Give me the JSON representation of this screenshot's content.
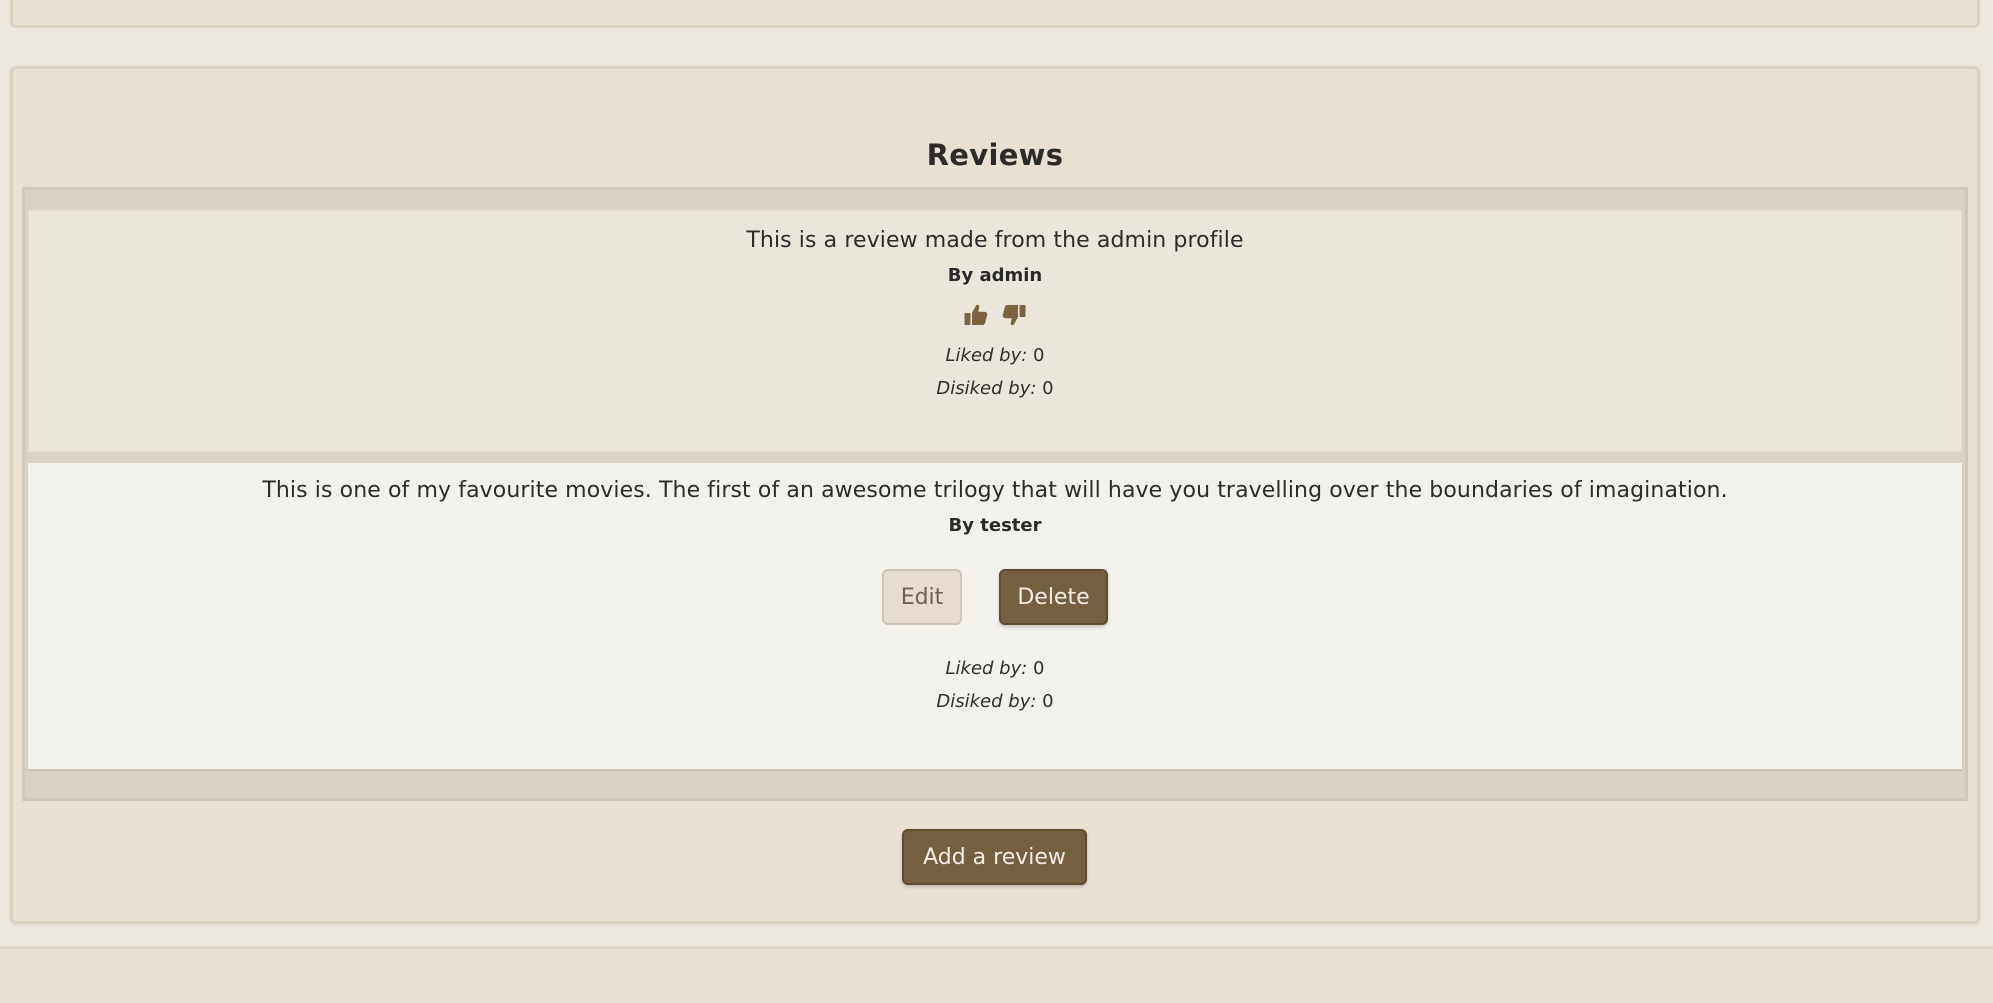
{
  "reviews_section": {
    "title": "Reviews",
    "add_review_label": "Add a review"
  },
  "reviews": [
    {
      "text": "This is a review made from the admin profile",
      "author": "By admin",
      "liked_label": "Liked by:",
      "liked_count": "0",
      "disliked_label": "Disiked by:",
      "disliked_count": "0",
      "icons": [
        "thumbs-up-icon",
        "thumbs-down-icon"
      ]
    },
    {
      "text": "This is one of my favourite movies. The first of an awesome trilogy that will have you travelling over the boundaries of imagination.",
      "author": "By tester",
      "edit_label": "Edit",
      "delete_label": "Delete",
      "liked_label": "Liked by:",
      "liked_count": "0",
      "disliked_label": "Disiked by:",
      "disliked_count": "0"
    }
  ],
  "colors": {
    "page_background": "#ebe7df",
    "card_background": "#e8e0d3",
    "accent_brown": "#745f3f",
    "icon_brown": "#7a6540",
    "edit_button_background": "#e6ddd0"
  }
}
